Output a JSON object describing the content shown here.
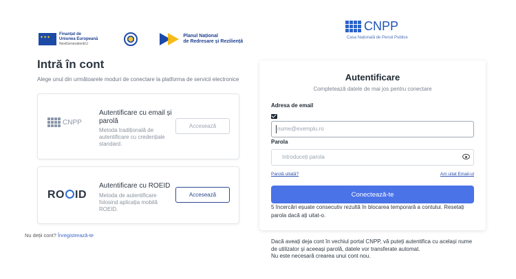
{
  "header": {
    "eu_logo": {
      "line1": "Finanțat de",
      "line2": "Uniunea Europeană",
      "line3": "NextGenerationEU"
    },
    "gov_seal_icon": "romanian-government-seal",
    "pnrr_logo": {
      "line1": "Planul Național",
      "line2": "de Redresare și Reziliență"
    },
    "brand": {
      "name": "CNPP",
      "subtitle": "Casa Națională de Pensii Publice"
    }
  },
  "left": {
    "title": "Intră în cont",
    "subtitle": "Alege unul din următoarele moduri de conectare la platforma de servicii electronice",
    "options": [
      {
        "logo_text": "CNPP",
        "title": "Autentificare cu email și parolă",
        "description": "Metoda tradițională de autentificare cu credențiale standard.",
        "button": "Accesează"
      },
      {
        "logo_text": "ROEID",
        "title": "Autentificare cu ROEID",
        "description": "Metoda de autentificare folosind aplicația mobilă ROEID.",
        "button": "Accesează"
      }
    ],
    "register_prompt": "Nu deții cont?",
    "register_link": "Înregistrează-te"
  },
  "auth": {
    "title": "Autentificare",
    "subtitle": "Completează datele de mai jos pentru conectare",
    "email_label": "Adresa de email",
    "email_placeholder": "nume@exemplu.ro",
    "password_label": "Parola",
    "password_placeholder": "Introduceți parola",
    "forgot_password": "Parolă uitată?",
    "forgot_email": "Am uitat Email-ul",
    "submit": "Conectează-te",
    "warning": "5 încercări eșuate consecutiv rezultă în blocarea temporară a contului. Resetați parola dacă ați uitat-o."
  },
  "info": {
    "line1": "Dacă aveați deja cont în vechiul portal CNPP, vă puteți autentifica cu același nume de utilizator și aceeași parolă, datele vor transferate automat.",
    "line2": "Nu este necesară crearea unui cont nou."
  },
  "colors": {
    "primary": "#4a73e8",
    "brand": "#1f55b8",
    "link": "#2a4fb0"
  }
}
